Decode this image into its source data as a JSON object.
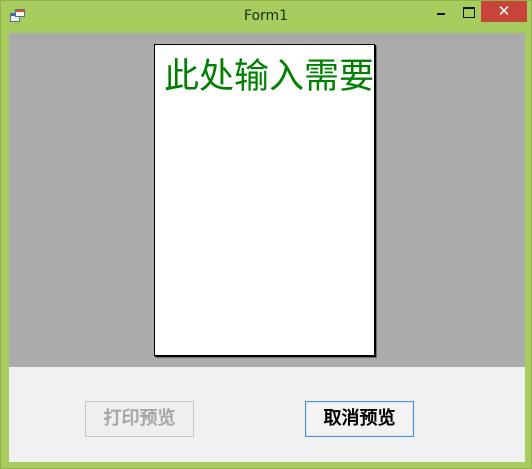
{
  "window": {
    "title": "Form1"
  },
  "title_buttons": {
    "minimize_icon": "minimize-icon",
    "maximize_icon": "maximize-icon",
    "close_icon": "close-icon",
    "close_glyph": "✕"
  },
  "preview": {
    "page_text": "此处输入需要"
  },
  "buttons": {
    "print_preview": "打印预览",
    "cancel_preview": "取消预览"
  },
  "colors": {
    "frame": "#a6cd5e",
    "close": "#c7443a",
    "preview_bg": "#ababab",
    "text": "#008000"
  }
}
